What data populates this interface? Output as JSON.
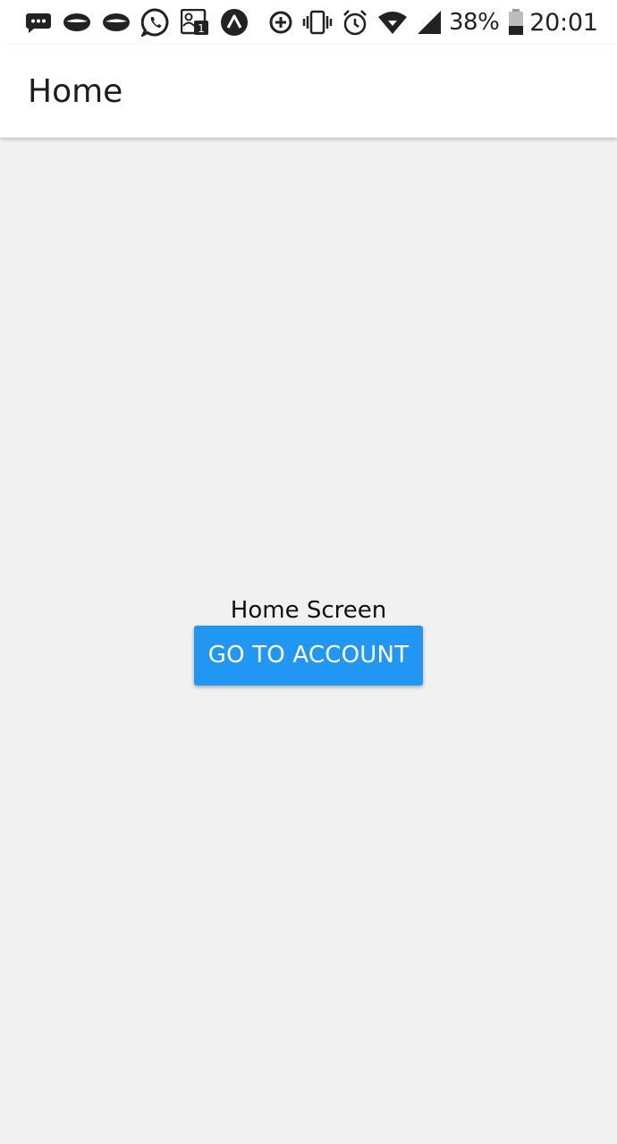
{
  "status_bar": {
    "notification_icons": [
      "chat-bubble-icon",
      "lips-icon",
      "lips-icon",
      "whatsapp-icon",
      "contacts-badge-icon",
      "expo-icon"
    ],
    "system_icons": [
      "data-saver-icon",
      "vibrate-icon",
      "alarm-icon",
      "wifi-icon",
      "signal-icon"
    ],
    "battery_percent": "38%",
    "battery_level": 0.38,
    "time": "20:01"
  },
  "app_bar": {
    "title": "Home"
  },
  "content": {
    "screen_label": "Home Screen",
    "button_label": "GO TO ACCOUNT"
  },
  "colors": {
    "primary": "#2196f3",
    "background": "#f1f1f1",
    "header": "#ffffff"
  }
}
